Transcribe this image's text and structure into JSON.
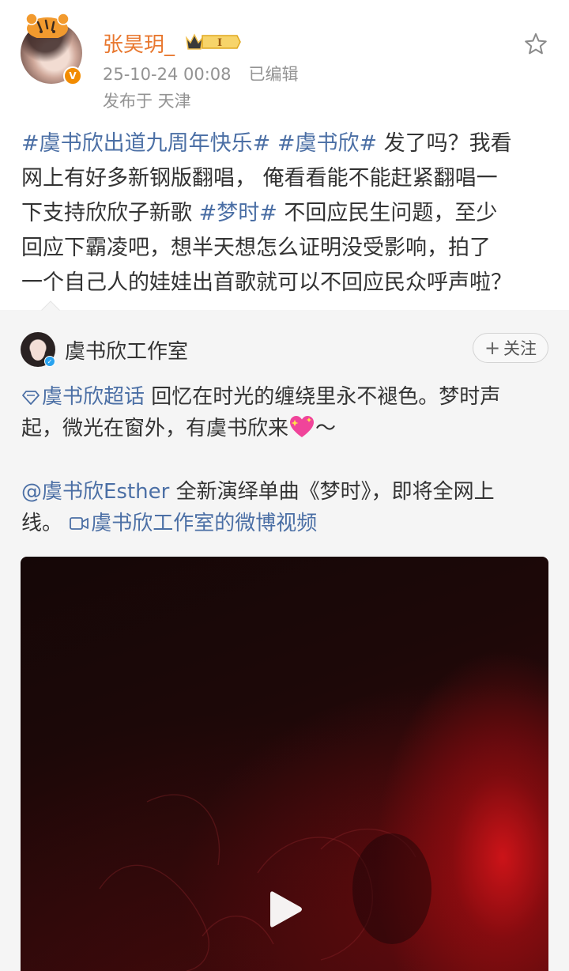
{
  "post": {
    "username": "张昊玥_",
    "vip_badge_text": "I",
    "timestamp": "25-10-24 00:08",
    "edited_label": "已编辑",
    "location": "发布于 天津",
    "text_segments": {
      "tag1": "#虞书欣出道九周年快乐#",
      "tag2": "#虞书欣#",
      "line1_rest": " 发了吗？我看",
      "line2": "网上有好多新钢版翻唱， 俺看看能不能赶紧翻唱一",
      "line3_pre": "下支持欣欣子新歌 ",
      "tag3": "#梦时#",
      "line3_rest": " 不回应民生问题，至少",
      "line4": "回应下霸凌吧，想半天想怎么证明没受影响，拍了",
      "line5": "一个自己人的娃娃出首歌就可以不回应民众呼声啦？"
    }
  },
  "repost": {
    "author": "虞书欣工作室",
    "follow_label": "关注",
    "chaohua_tag": "虞书欣超话",
    "line1_rest": " 回忆在时光的缠绕里永不褪色。梦时声",
    "line2_pre": "起，微光在窗外，有虞书欣来",
    "line2_tail": "～",
    "mention": "@虞书欣Esther",
    "line4_rest": " 全新演绎单曲《梦时》，即将全网上",
    "line5_pre": "线。 ",
    "video_link": "虞书欣工作室的微博视频"
  },
  "icons": {
    "star": "star-icon",
    "play": "play-icon",
    "chaohua": "chaohua-diamond-icon",
    "video": "video-camera-icon",
    "heart": "sparkling-heart-icon"
  },
  "colors": {
    "link_blue": "#4b6fa5",
    "username_orange": "#e8772e",
    "meta_gray": "#939393"
  }
}
